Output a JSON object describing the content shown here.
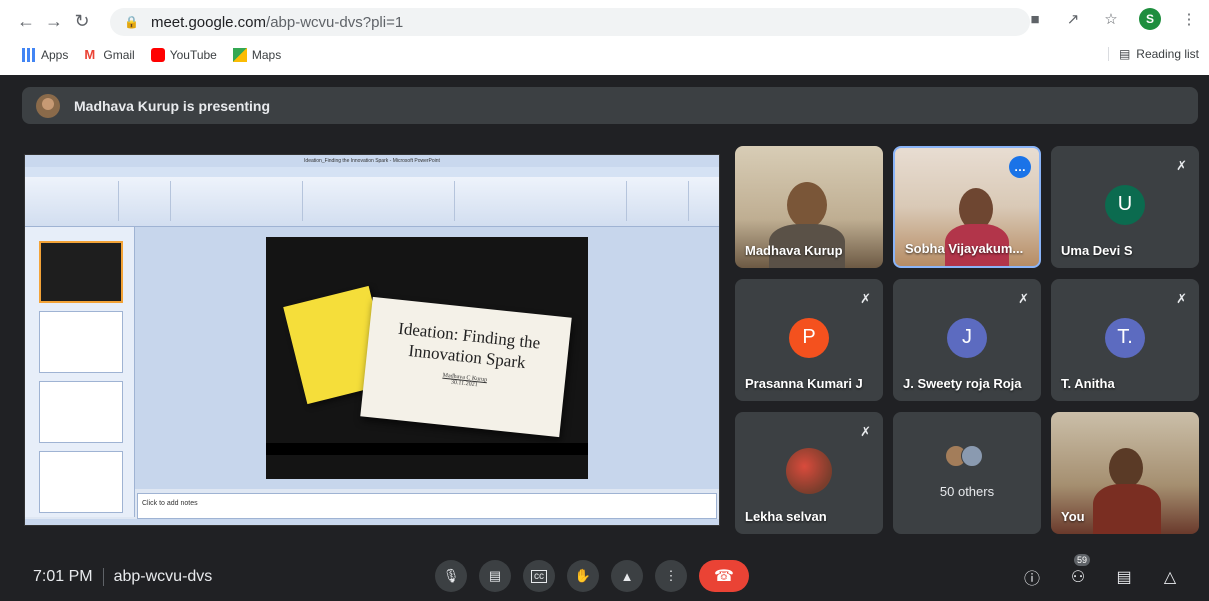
{
  "browser": {
    "url_host": "meet.google.com",
    "url_path": "/abp-wcvu-dvs?pli=1",
    "profile_initial": "S",
    "bookmarks": [
      {
        "label": "Apps",
        "color": "#4285f4"
      },
      {
        "label": "Gmail",
        "color": "#ea4335"
      },
      {
        "label": "YouTube",
        "color": "#ff0000"
      },
      {
        "label": "Maps",
        "color": "#34a853"
      }
    ],
    "reading_list": "Reading list"
  },
  "meet": {
    "presenting_text": "Madhava Kurup is presenting",
    "meeting_code": "abp-wcvu-dvs",
    "time": "7:01 PM",
    "participants_count": "59"
  },
  "shared_screen": {
    "window_title": "Ideation_Finding the Innovation Spark - Microsoft PowerPoint",
    "slide_title": "Ideation: Finding the Innovation Spark",
    "slide_author": "Madhava C Kurup",
    "slide_date": "30.11.2021",
    "notes_placeholder": "Click to add notes"
  },
  "tiles": [
    {
      "name": "Madhava Kurup",
      "type": "video"
    },
    {
      "name": "Sobha Vijayakum...",
      "type": "video"
    },
    {
      "name": "Uma Devi S",
      "type": "avatar",
      "initial": "U",
      "color": "#0b6b4f"
    },
    {
      "name": "Prasanna Kumari J",
      "type": "avatar",
      "initial": "P",
      "color": "#f4511e"
    },
    {
      "name": "J. Sweety roja Roja",
      "type": "avatar",
      "initial": "J",
      "color": "#5c6bc0"
    },
    {
      "name": "T. Anitha",
      "type": "avatar",
      "initial": "T.",
      "color": "#5c6bc0"
    },
    {
      "name": "Lekha selvan",
      "type": "photo"
    },
    {
      "name": "50 others",
      "type": "others"
    },
    {
      "name": "You",
      "type": "video"
    }
  ]
}
